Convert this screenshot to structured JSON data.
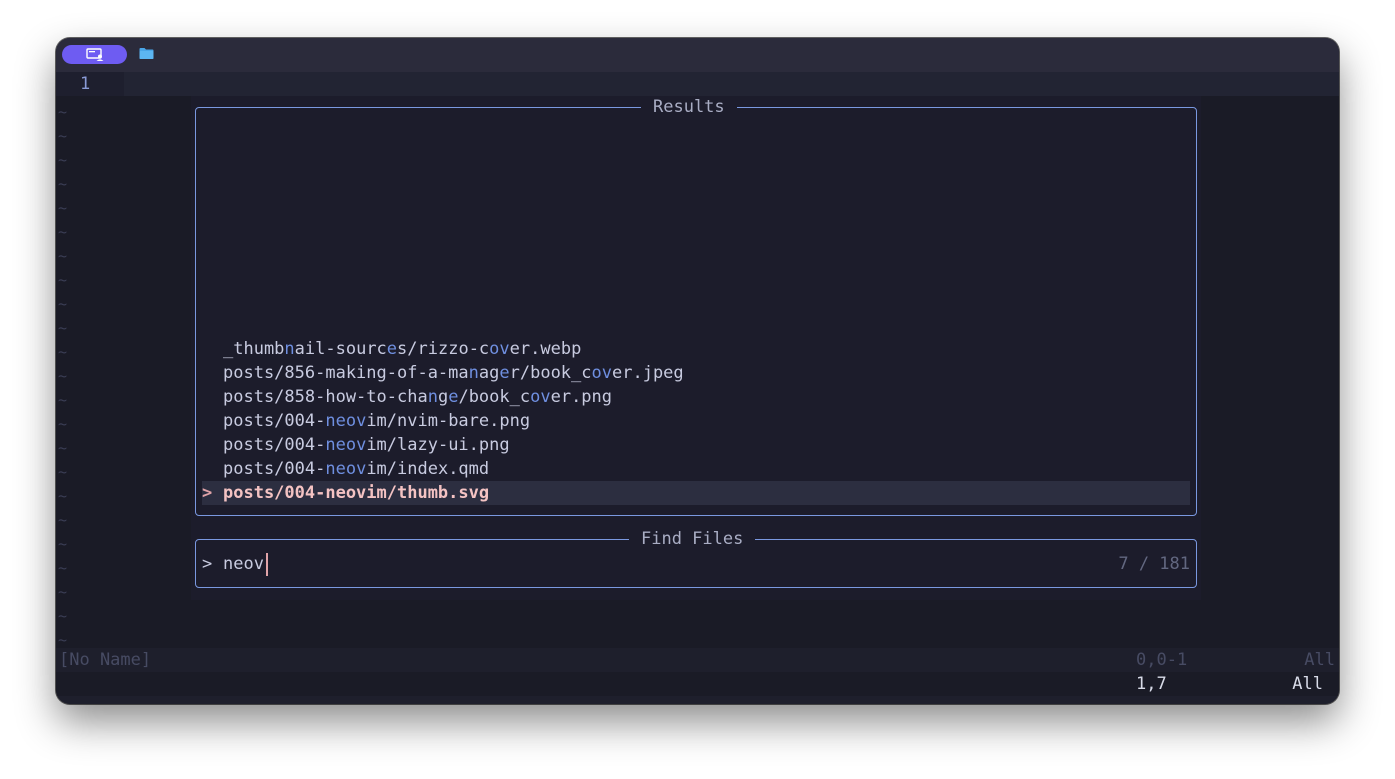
{
  "editor": {
    "line_number": "1",
    "tilde": "~"
  },
  "telescope": {
    "results_title": "Results",
    "prompt_title": "Find Files",
    "results": [
      [
        {
          "t": "_thumb"
        },
        {
          "t": "n",
          "h": true
        },
        {
          "t": "ail-sourc"
        },
        {
          "t": "e",
          "h": true
        },
        {
          "t": "s/rizzo-c"
        },
        {
          "t": "ov",
          "h": true
        },
        {
          "t": "er.webp"
        }
      ],
      [
        {
          "t": "posts/856-making-of-a-ma"
        },
        {
          "t": "n",
          "h": true
        },
        {
          "t": "ag"
        },
        {
          "t": "e",
          "h": true
        },
        {
          "t": "r/book_c"
        },
        {
          "t": "ov",
          "h": true
        },
        {
          "t": "er.jpeg"
        }
      ],
      [
        {
          "t": "posts/858-how-to-cha"
        },
        {
          "t": "n",
          "h": true
        },
        {
          "t": "g"
        },
        {
          "t": "e",
          "h": true
        },
        {
          "t": "/book_c"
        },
        {
          "t": "ov",
          "h": true
        },
        {
          "t": "er.png"
        }
      ],
      [
        {
          "t": "posts/004-"
        },
        {
          "t": "neov",
          "h": true
        },
        {
          "t": "im/nvim-bare.png"
        }
      ],
      [
        {
          "t": "posts/004-"
        },
        {
          "t": "neov",
          "h": true
        },
        {
          "t": "im/lazy-ui.png"
        }
      ],
      [
        {
          "t": "posts/004-"
        },
        {
          "t": "neov",
          "h": true
        },
        {
          "t": "im/index.qmd"
        }
      ]
    ],
    "selected_caret": ">",
    "selected_result": "posts/004-neovim/thumb.svg",
    "prompt_prefix": ">",
    "query": "neov",
    "counter": "7 / 181"
  },
  "statusline": {
    "filename": "[No Name]",
    "position": "0,0-1",
    "scroll": "All"
  },
  "cmdline": {
    "position": "1,7",
    "scroll": "All"
  },
  "colors": {
    "accent": "#6e5cf2",
    "border": "#7a98e0",
    "match_highlight": "#6f8fe0",
    "selection_text": "#f4c3c3"
  },
  "icons": [
    "terminal-session-icon",
    "folder-icon"
  ]
}
